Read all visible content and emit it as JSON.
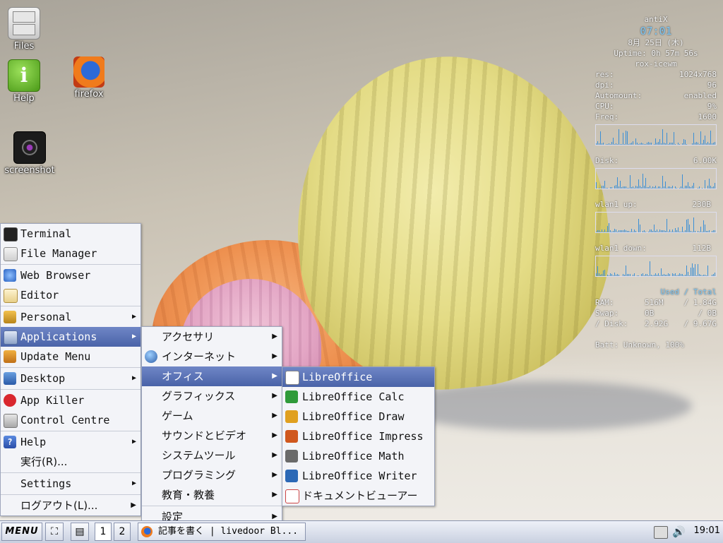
{
  "desktop": {
    "icons": [
      {
        "label": "Files"
      },
      {
        "label": "Help"
      },
      {
        "label": "firefox"
      },
      {
        "label": "screenshot"
      }
    ]
  },
  "conky": {
    "hostname": "antiX",
    "time": "07:01",
    "date": "8月 25日 (木)",
    "uptime": "Uptime: 0h 57m 56s",
    "wm": "rox-icewm",
    "res_label": "res:",
    "res_value": "1024x768",
    "dpi_label": "dpi:",
    "dpi_value": "96",
    "automount_label": "Automount:",
    "automount_value": "enabled",
    "cpu_label": "CPU:",
    "cpu_value": "9%",
    "freq_label": "Freq:",
    "freq_value": "1600",
    "disk_label": "Disk:",
    "disk_value": "6.00K",
    "wlan_up_label": "wlan1 up:",
    "wlan_up_value": "230B",
    "wlan_down_label": "wlan1 down:",
    "wlan_down_value": "112B",
    "used_total": "Used / Total",
    "ram_label": "RAM:",
    "ram_used": "516M",
    "ram_total": "/ 1.84G",
    "swap_label": "Swap:",
    "swap_used": "0B",
    "swap_total": "/ 0B",
    "disk2_label": "/ Disk:",
    "disk2_used": "2.92G",
    "disk2_total": "/ 9.67G",
    "batt": "Batt: Unknown, 100%"
  },
  "main_menu": {
    "terminal": "Terminal",
    "file_manager": "File Manager",
    "web_browser": "Web Browser",
    "editor": "Editor",
    "personal": "Personal",
    "applications": "Applications",
    "update_menu": "Update Menu",
    "desktop": "Desktop",
    "app_killer": "App Killer",
    "control_centre": "Control Centre",
    "help": "Help",
    "run": "実行(R)...",
    "settings": "Settings",
    "logout": "ログアウト(L)..."
  },
  "apps_menu": {
    "items": [
      "アクセサリ",
      "インターネット",
      "オフィス",
      "グラフィックス",
      "ゲーム",
      "サウンドとビデオ",
      "システムツール",
      "プログラミング",
      "教育・教養"
    ],
    "settings": "設定"
  },
  "office_menu": {
    "items": [
      "LibreOffice",
      "LibreOffice Calc",
      "LibreOffice Draw",
      "LibreOffice Impress",
      "LibreOffice Math",
      "LibreOffice Writer",
      "ドキュメントビューアー"
    ]
  },
  "taskbar": {
    "menu_label": "MENU",
    "workspaces": [
      "1",
      "2"
    ],
    "task_title": "記事を書く | livedoor Bl...",
    "clock": "19:01"
  }
}
